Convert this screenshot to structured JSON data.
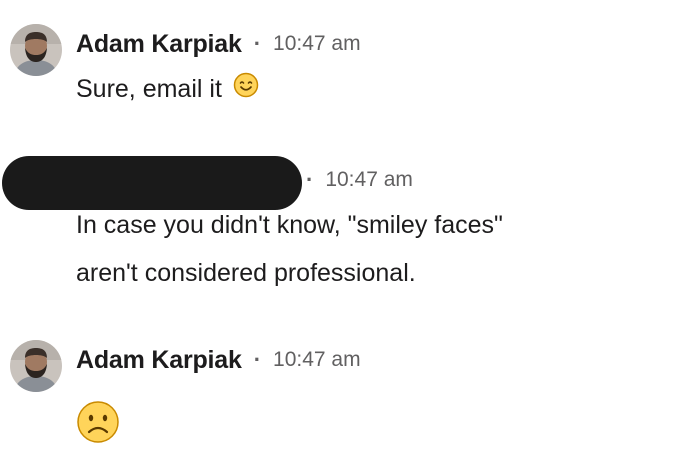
{
  "messages": [
    {
      "author": "Adam Karpiak",
      "separator": "·",
      "time": "10:47 am",
      "text": "Sure, email it",
      "emoji": "smiling-face"
    },
    {
      "author": "",
      "author_redacted": true,
      "separator": "·",
      "time": "10:47 am",
      "lines": [
        "In case you didn't know, \"smiley faces\"",
        "aren't considered professional."
      ]
    },
    {
      "author": "Adam Karpiak",
      "separator": "·",
      "time": "10:47 am",
      "text": "",
      "emoji": "frowning-face"
    }
  ],
  "colors": {
    "text": "#1d1c1d",
    "meta": "#616061",
    "emoji_fill": "#ffd45a",
    "emoji_stroke": "#c98a00",
    "redaction": "#1a1a1a"
  }
}
